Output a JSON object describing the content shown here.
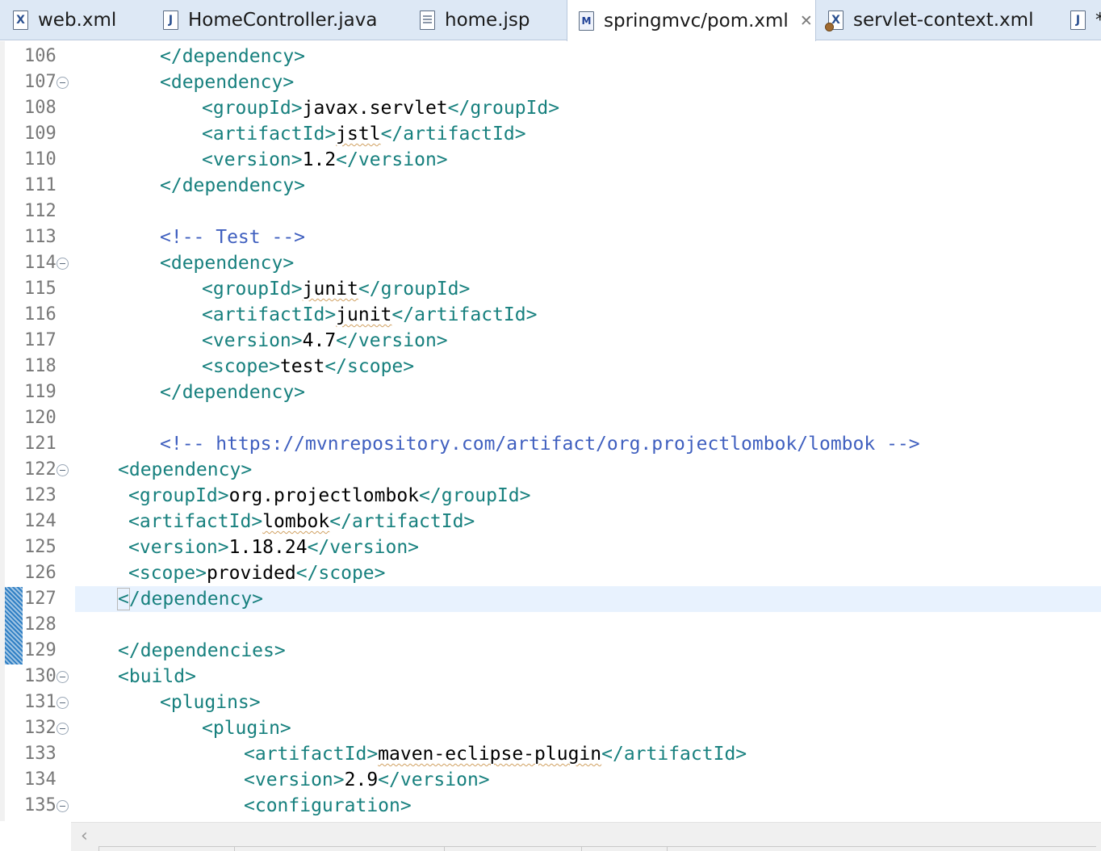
{
  "tabs": [
    {
      "label": "web.xml",
      "icon": "xml-file-icon",
      "active": false,
      "dirty": false
    },
    {
      "label": "HomeController.java",
      "icon": "java-file-icon",
      "active": false,
      "dirty": false
    },
    {
      "label": "home.jsp",
      "icon": "jsp-file-icon",
      "active": false,
      "dirty": false
    },
    {
      "label": "springmvc/pom.xml",
      "icon": "maven-pom-icon",
      "active": true,
      "dirty": false
    },
    {
      "label": "servlet-context.xml",
      "icon": "spring-xml-file-icon",
      "active": false,
      "dirty": false
    },
    {
      "label": "*",
      "icon": "java-file-icon",
      "active": false,
      "dirty": true
    }
  ],
  "editor": {
    "current_line": 127,
    "lines": [
      {
        "n": "106",
        "fold": false,
        "indent": 2,
        "tokens": [
          [
            "tg",
            "</dependency>"
          ]
        ]
      },
      {
        "n": "107",
        "fold": true,
        "indent": 2,
        "tokens": [
          [
            "tg",
            "<dependency>"
          ]
        ]
      },
      {
        "n": "108",
        "fold": false,
        "indent": 3,
        "tokens": [
          [
            "tg",
            "<groupId>"
          ],
          [
            "tx",
            "javax.servlet"
          ],
          [
            "tg",
            "</groupId>"
          ]
        ]
      },
      {
        "n": "109",
        "fold": false,
        "indent": 3,
        "tokens": [
          [
            "tg",
            "<artifactId>"
          ],
          [
            "tx sq",
            "jstl"
          ],
          [
            "tg",
            "</artifactId>"
          ]
        ]
      },
      {
        "n": "110",
        "fold": false,
        "indent": 3,
        "tokens": [
          [
            "tg",
            "<version>"
          ],
          [
            "tx",
            "1.2"
          ],
          [
            "tg",
            "</version>"
          ]
        ]
      },
      {
        "n": "111",
        "fold": false,
        "indent": 2,
        "tokens": [
          [
            "tg",
            "</dependency>"
          ]
        ]
      },
      {
        "n": "112",
        "fold": false,
        "indent": 0,
        "tokens": []
      },
      {
        "n": "113",
        "fold": false,
        "indent": 2,
        "tokens": [
          [
            "cm",
            "<!-- Test -->"
          ]
        ]
      },
      {
        "n": "114",
        "fold": true,
        "indent": 2,
        "tokens": [
          [
            "tg",
            "<dependency>"
          ]
        ]
      },
      {
        "n": "115",
        "fold": false,
        "indent": 3,
        "tokens": [
          [
            "tg",
            "<groupId>"
          ],
          [
            "tx sq",
            "junit"
          ],
          [
            "tg",
            "</groupId>"
          ]
        ]
      },
      {
        "n": "116",
        "fold": false,
        "indent": 3,
        "tokens": [
          [
            "tg",
            "<artifactId>"
          ],
          [
            "tx sq",
            "junit"
          ],
          [
            "tg",
            "</artifactId>"
          ]
        ]
      },
      {
        "n": "117",
        "fold": false,
        "indent": 3,
        "tokens": [
          [
            "tg",
            "<version>"
          ],
          [
            "tx",
            "4.7"
          ],
          [
            "tg",
            "</version>"
          ]
        ]
      },
      {
        "n": "118",
        "fold": false,
        "indent": 3,
        "tokens": [
          [
            "tg",
            "<scope>"
          ],
          [
            "tx",
            "test"
          ],
          [
            "tg",
            "</scope>"
          ]
        ]
      },
      {
        "n": "119",
        "fold": false,
        "indent": 2,
        "tokens": [
          [
            "tg",
            "</dependency>"
          ]
        ]
      },
      {
        "n": "120",
        "fold": false,
        "indent": 0,
        "tokens": []
      },
      {
        "n": "121",
        "fold": false,
        "indent": 2,
        "tokens": [
          [
            "cm",
            "<!-- https://mvnrepository.com/artifact/org.projectlombok/lombok -->"
          ]
        ]
      },
      {
        "n": "122",
        "fold": true,
        "indent": 1,
        "tokens": [
          [
            "tg",
            "<dependency>"
          ]
        ]
      },
      {
        "n": "123",
        "fold": false,
        "indent": 1.25,
        "tokens": [
          [
            "tg",
            "<groupId>"
          ],
          [
            "tx",
            "org.projectlombok"
          ],
          [
            "tg",
            "</groupId>"
          ]
        ]
      },
      {
        "n": "124",
        "fold": false,
        "indent": 1.25,
        "tokens": [
          [
            "tg",
            "<artifactId>"
          ],
          [
            "tx sq",
            "lombok"
          ],
          [
            "tg",
            "</artifactId>"
          ]
        ]
      },
      {
        "n": "125",
        "fold": false,
        "indent": 1.25,
        "tokens": [
          [
            "tg",
            "<version>"
          ],
          [
            "tx",
            "1.18.24"
          ],
          [
            "tg",
            "</version>"
          ]
        ]
      },
      {
        "n": "126",
        "fold": false,
        "indent": 1.25,
        "tokens": [
          [
            "tg",
            "<scope>"
          ],
          [
            "tx",
            "provided"
          ],
          [
            "tg",
            "</scope>"
          ]
        ]
      },
      {
        "n": "127",
        "fold": false,
        "indent": 1,
        "tokens": [
          [
            "tg caret-box",
            "<"
          ],
          [
            "tg",
            "/dependency>"
          ]
        ]
      },
      {
        "n": "128",
        "fold": false,
        "indent": 0,
        "tokens": []
      },
      {
        "n": "129",
        "fold": false,
        "indent": 1,
        "tokens": [
          [
            "tg",
            "</dependencies>"
          ]
        ]
      },
      {
        "n": "130",
        "fold": true,
        "indent": 1,
        "tokens": [
          [
            "tg",
            "<build>"
          ]
        ]
      },
      {
        "n": "131",
        "fold": true,
        "indent": 2,
        "tokens": [
          [
            "tg",
            "<plugins>"
          ]
        ]
      },
      {
        "n": "132",
        "fold": true,
        "indent": 3,
        "tokens": [
          [
            "tg",
            "<plugin>"
          ]
        ]
      },
      {
        "n": "133",
        "fold": false,
        "indent": 4,
        "tokens": [
          [
            "tg",
            "<artifactId>"
          ],
          [
            "tx sq",
            "maven-eclipse-plugin"
          ],
          [
            "tg",
            "</artifactId>"
          ]
        ]
      },
      {
        "n": "134",
        "fold": false,
        "indent": 4,
        "tokens": [
          [
            "tg",
            "<version>"
          ],
          [
            "tx",
            "2.9"
          ],
          [
            "tg",
            "</version>"
          ]
        ]
      },
      {
        "n": "135",
        "fold": true,
        "indent": 4,
        "tokens": [
          [
            "tg",
            "<configuration>"
          ]
        ]
      }
    ]
  },
  "colors": {
    "tag": "#17807e",
    "text": "#000000",
    "comment": "#3f5fbf",
    "current_line_bg": "#e8f2fe",
    "tab_bar_bg": "#dde8f5",
    "change_marker": "#2f7fc4"
  }
}
